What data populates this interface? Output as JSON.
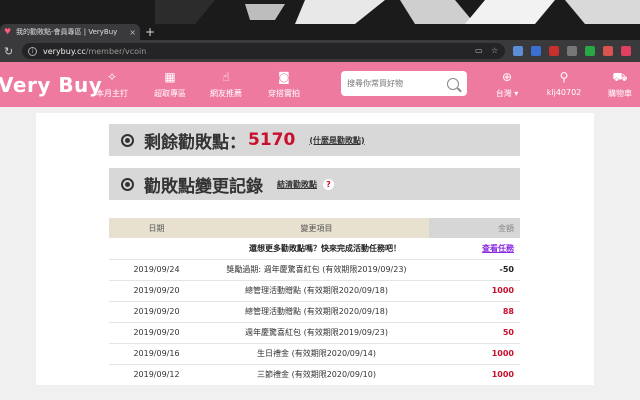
{
  "browser": {
    "tab_title": "我的勸敗點-會員專區 | VeryBuy",
    "tab_close": "×",
    "new_tab": "+",
    "url_host": "verybuy.cc",
    "url_path": "/member/vcoin"
  },
  "header": {
    "logo": "Very Buy",
    "nav": [
      {
        "label": "本月主打",
        "icon": "sparkle-icon"
      },
      {
        "label": "超取專區",
        "icon": "store-icon"
      },
      {
        "label": "網友推薦",
        "icon": "thumbs-up-icon"
      },
      {
        "label": "穿搭實拍",
        "icon": "camera-icon"
      }
    ],
    "search_placeholder": "搜尋你常買好物",
    "region": "台灣",
    "user": "klj40702",
    "cart": "購物車",
    "brand_color": "#ef7aa0"
  },
  "balance": {
    "label": "剩餘勸敗點：",
    "points": "5170",
    "link": "(什麼是勸敗點)"
  },
  "history": {
    "title": "勸敗點變更記錄",
    "link": "結清勸敗點",
    "help": "?",
    "columns": [
      "日期",
      "變更項目",
      "金額"
    ],
    "promo": {
      "text": "還想更多勸敗點嗎？快來完成活動任務吧！",
      "link": "查看任務"
    },
    "rows": [
      {
        "date": "2019/09/24",
        "item": "獎勵過期: 週年慶驚喜紅包 (有效期限2019/09/23)",
        "amount": "-50",
        "type": "neg"
      },
      {
        "date": "2019/09/20",
        "item": "總管理活動贈點 (有效期限2020/09/18)",
        "amount": "1000",
        "type": "pos"
      },
      {
        "date": "2019/09/20",
        "item": "總管理活動贈點 (有效期限2020/09/18)",
        "amount": "88",
        "type": "pos"
      },
      {
        "date": "2019/09/20",
        "item": "週年慶驚喜紅包 (有效期限2019/09/23)",
        "amount": "50",
        "type": "pos"
      },
      {
        "date": "2019/09/16",
        "item": "生日禮金 (有效期限2020/09/14)",
        "amount": "1000",
        "type": "pos"
      },
      {
        "date": "2019/09/12",
        "item": "三節禮金 (有效期限2020/09/10)",
        "amount": "1000",
        "type": "pos"
      }
    ]
  }
}
